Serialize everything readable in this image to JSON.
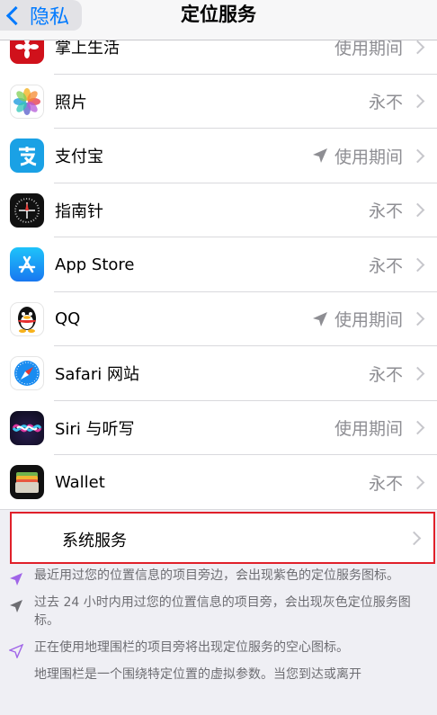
{
  "nav": {
    "back_label": "隐私",
    "title": "定位服务"
  },
  "apps": [
    {
      "name": "掌上生活",
      "value": "使用期间",
      "arrow": false,
      "icon": "cmb-flower-icon",
      "icon_bg": "#d0111b"
    },
    {
      "name": "照片",
      "value": "永不",
      "arrow": false,
      "icon": "photos-icon",
      "icon_bg": "#ffffff"
    },
    {
      "name": "支付宝",
      "value": "使用期间",
      "arrow": true,
      "icon": "alipay-icon",
      "icon_bg": "#1aa1e5"
    },
    {
      "name": "指南针",
      "value": "永不",
      "arrow": false,
      "icon": "compass-icon",
      "icon_bg": "#111111"
    },
    {
      "name": "App Store",
      "value": "永不",
      "arrow": false,
      "icon": "app-store-icon",
      "icon_bg": "#1e86f7"
    },
    {
      "name": "QQ",
      "value": "使用期间",
      "arrow": true,
      "icon": "qq-penguin-icon",
      "icon_bg": "#ffffff"
    },
    {
      "name": "Safari 网站",
      "value": "永不",
      "arrow": false,
      "icon": "safari-icon",
      "icon_bg": "#ffffff"
    },
    {
      "name": "Siri 与听写",
      "value": "使用期间",
      "arrow": false,
      "icon": "siri-icon",
      "icon_bg": "#111122"
    },
    {
      "name": "Wallet",
      "value": "永不",
      "arrow": false,
      "icon": "wallet-icon",
      "icon_bg": "#111111"
    }
  ],
  "system_services": {
    "label": "系统服务"
  },
  "notes": [
    {
      "icon": "purple-arrow-icon",
      "color": "#a065e8",
      "text": "最近用过您的位置信息的项目旁边，会出现紫色的定位服务图标。"
    },
    {
      "icon": "gray-arrow-icon",
      "color": "#6d6d72",
      "text": "过去 24 小时内用过您的位置信息的项目旁，会出现灰色定位服务图标。"
    },
    {
      "icon": "hollow-purple-arrow-icon",
      "color": "#a065e8",
      "text": "正在使用地理围栏的项目旁将出现定位服务的空心图标。"
    },
    {
      "icon": "",
      "color": "",
      "text": "地理围栏是一个围绕特定位置的虚拟参数。当您到达或离开"
    }
  ],
  "colors": {
    "accent": "#007aff",
    "highlight_border": "#e0202a"
  }
}
